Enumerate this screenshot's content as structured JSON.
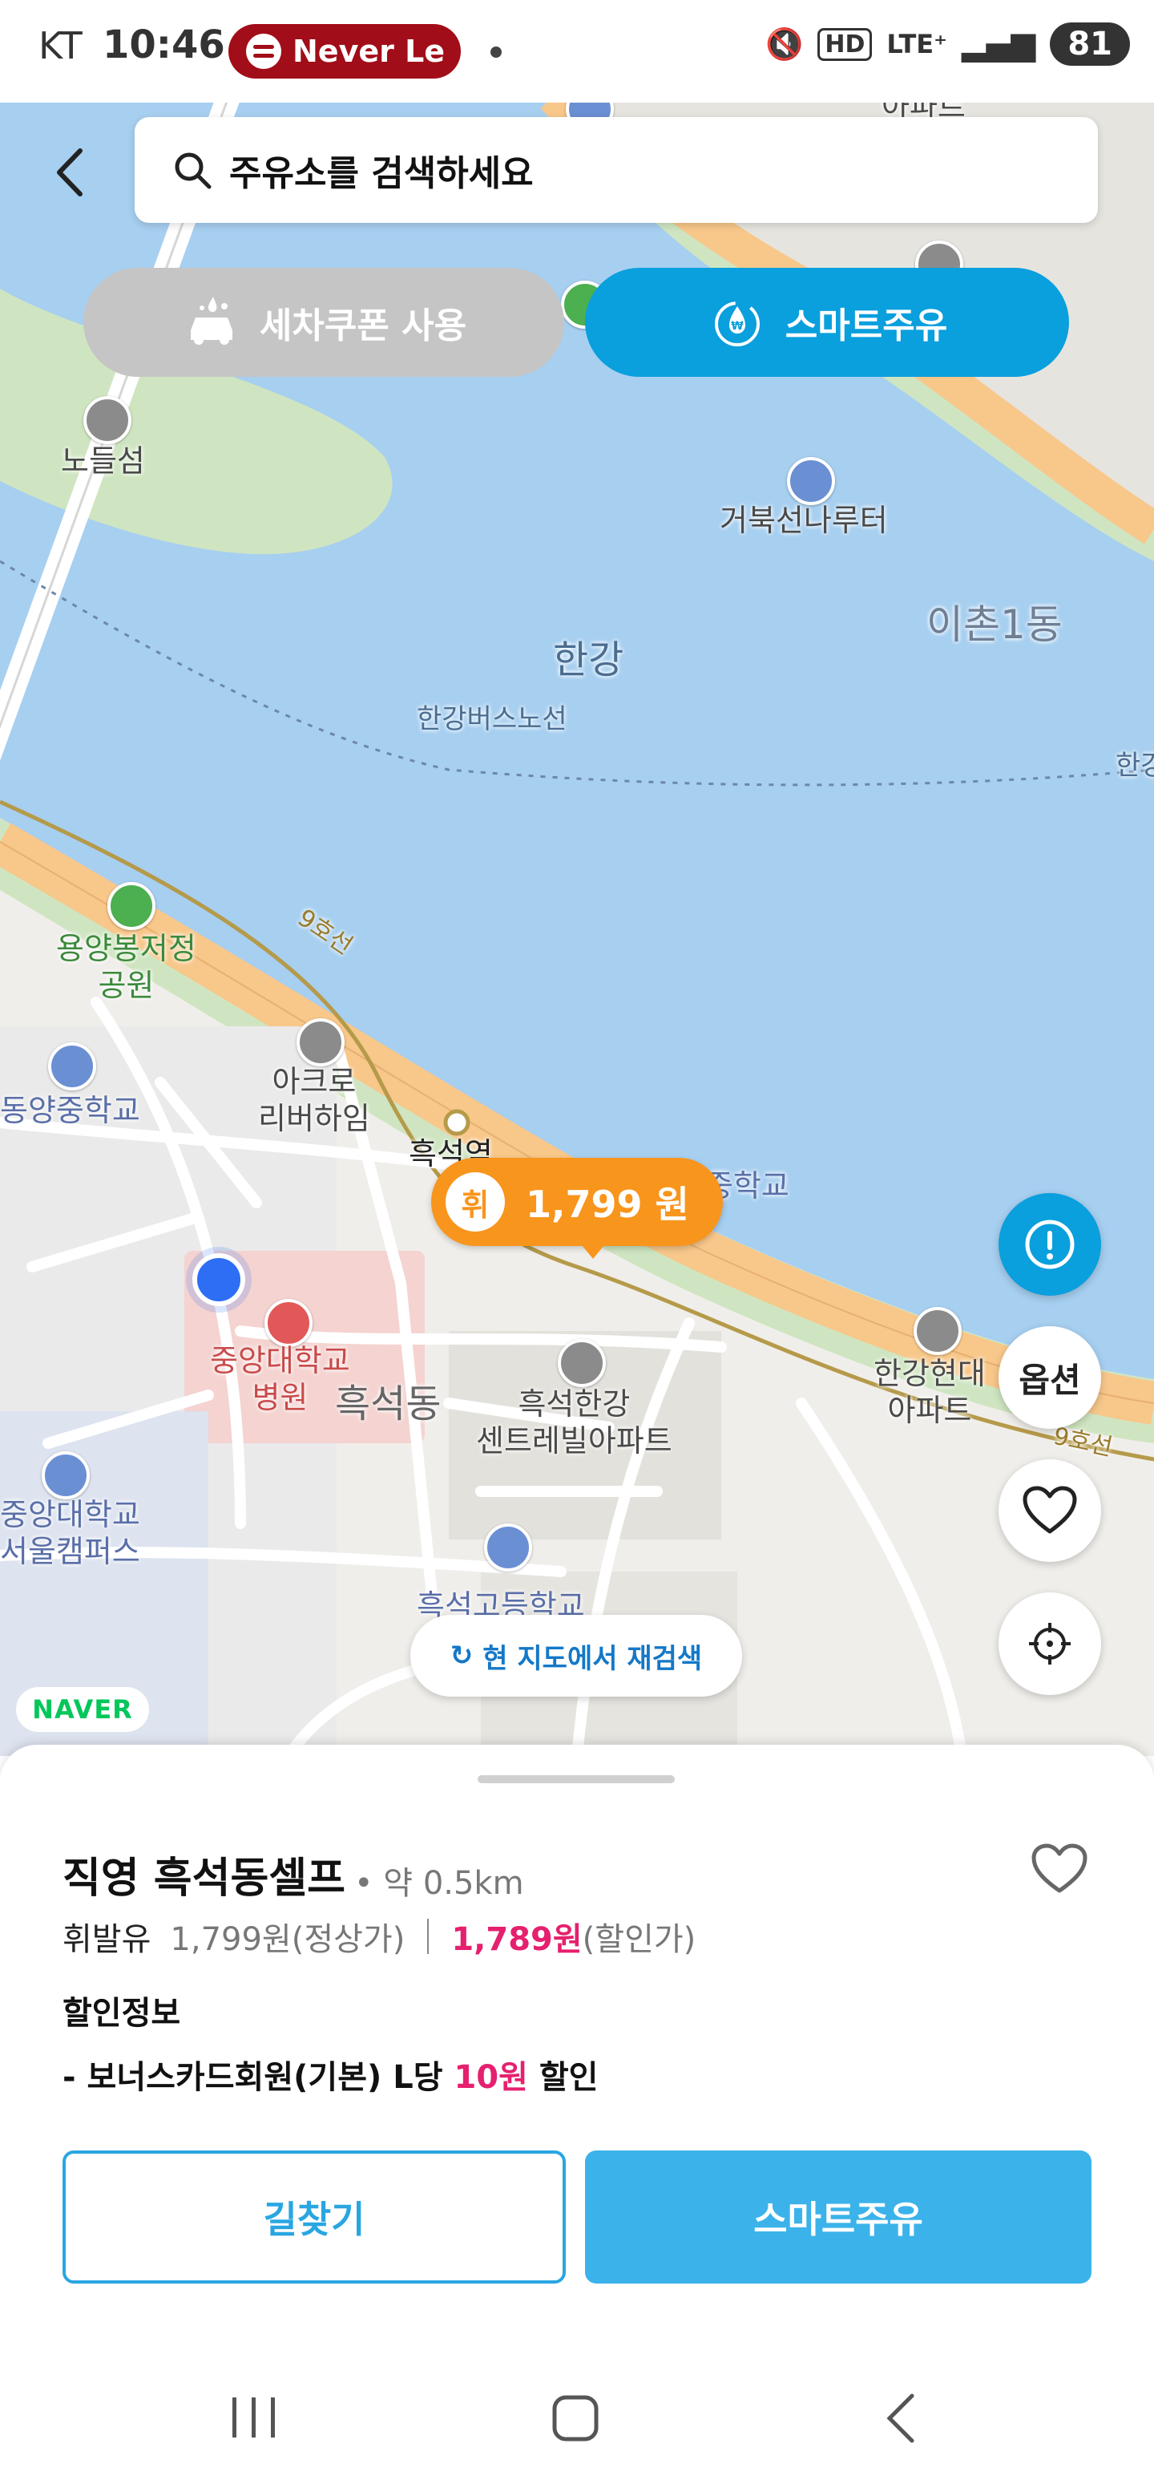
{
  "status_bar": {
    "carrier": "KT",
    "time": "10:46",
    "media_label": "Never Le",
    "network": "LTE⁺",
    "hd": "HD",
    "battery": "81"
  },
  "search": {
    "placeholder": "주유소를 검색하세요"
  },
  "chips": {
    "wash": "세차쿠폰 사용",
    "smart": "스마트주유"
  },
  "map": {
    "labels": {
      "nodeulseom": "노들섬",
      "geobukseon": "거북선나루터",
      "ichon": "이촌1동",
      "hangang": "한강",
      "bus_route": "한강버스노선",
      "bus_route_2": "한강",
      "yongyang": "용양봉저정\n공원",
      "line9": "9호선",
      "line9_b": "9호선",
      "acro": "아크로\n리버하임",
      "dongyang": "동양중학교",
      "heukseok_station": "흑석역",
      "school_right": "중학교",
      "cau_hospital": "중앙대학교\n병원",
      "heukseokdong": "흑석동",
      "heukseok_hangang": "흑석한강\n센트레빌아파트",
      "hangang_hyundai": "한강현대\n아파트",
      "cau_campus": "중앙대학교\n서울캠퍼스",
      "heukseok_high": "흑석고등학교",
      "apt_top": "아파트"
    },
    "price_marker": {
      "badge": "휘",
      "price": "1,799 원"
    },
    "rescan": "현 지도에서 재검색",
    "naver": "NAVER",
    "option": "옵션"
  },
  "station": {
    "name": "직영 흑석동셀프",
    "distance": "• 약 0.5km",
    "fuel_type": "휘발유",
    "regular_price": "1,799원(정상가)",
    "discount_price": "1,789원",
    "discount_suffix": "(할인가)",
    "discount_title": "할인정보",
    "discount_prefix": "- 보너스카드회원(기본) L당 ",
    "discount_amount": "10원",
    "discount_tail": " 할인"
  },
  "buttons": {
    "route": "길찾기",
    "smart": "스마트주유"
  },
  "colors": {
    "accent": "#0a9fdd",
    "marker": "#f8951d",
    "discount": "#e5206e",
    "river": "#a7cff0"
  }
}
